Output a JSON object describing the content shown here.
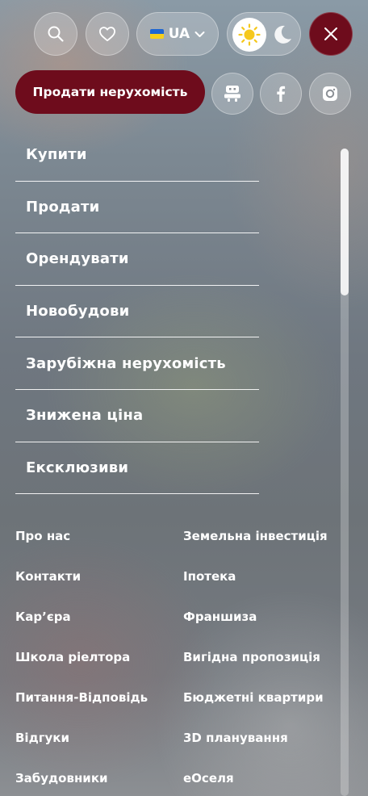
{
  "header": {
    "language": "UA",
    "sell_button_label": "Продати нерухомість"
  },
  "icons": {
    "search": "search-icon",
    "favorites": "heart-icon",
    "flag": "ukraine-flag-icon",
    "language_chevron": "chevron-down-icon",
    "theme_light": "sun-icon",
    "theme_dark": "moon-icon",
    "close": "close-icon",
    "bot": "robot-icon",
    "facebook": "facebook-icon",
    "instagram": "instagram-icon"
  },
  "colors": {
    "accent": "#6e0c1c",
    "sun": "#f5c81e"
  },
  "main_menu": [
    {
      "label": "Купити"
    },
    {
      "label": "Продати"
    },
    {
      "label": "Орендувати"
    },
    {
      "label": "Новобудови"
    },
    {
      "label": "Зарубіжна нерухомість"
    },
    {
      "label": "Знижена ціна"
    },
    {
      "label": "Ексклюзиви"
    }
  ],
  "secondary_menu": {
    "left": [
      {
        "label": "Про нас"
      },
      {
        "label": "Контакти"
      },
      {
        "label": "Кар’єра"
      },
      {
        "label": "Школа ріелтора"
      },
      {
        "label": "Питання-Відповідь"
      },
      {
        "label": "Відгуки"
      },
      {
        "label": "Забудовники"
      }
    ],
    "right": [
      {
        "label": "Земельна інвестиція"
      },
      {
        "label": "Іпотека"
      },
      {
        "label": "Франшиза"
      },
      {
        "label": "Вигідна пропозиція"
      },
      {
        "label": "Бюджетні квартири"
      },
      {
        "label": "3D планування"
      },
      {
        "label": "еОселя"
      }
    ]
  }
}
